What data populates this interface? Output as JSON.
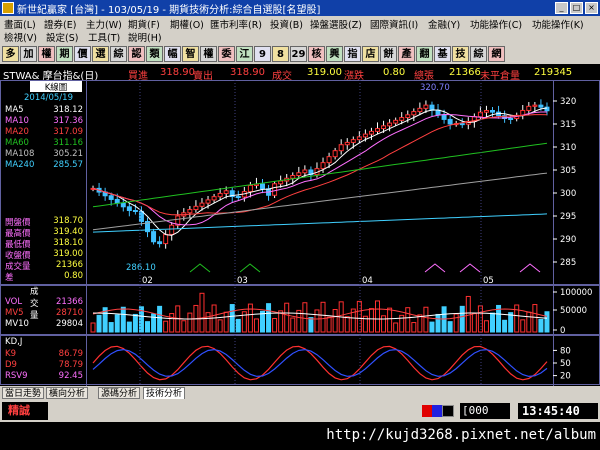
{
  "window": {
    "title": "新世紀贏家 [台灣] - 103/05/19 - 期貨技術分析:綜合自選股[名望股]"
  },
  "menus": {
    "row1": [
      "畫面(L)",
      "證券(E)",
      "主力(W)",
      "期貨(F)",
      "期權(O)",
      "匯市利率(R)",
      "投資(B)",
      "操盤選股(Z)",
      "國際資訊(I)",
      "金融(Y)",
      "功能操作(C)",
      "功能操作(K)"
    ],
    "row2": [
      "檢視(V)",
      "設定(S)",
      "工具(T)",
      "說明(H)"
    ]
  },
  "toolbar": [
    "多",
    "加",
    "權",
    "期",
    "價",
    "選",
    "綜",
    "認",
    "類",
    "幅",
    "智",
    "權",
    "委",
    "江",
    "9",
    "8",
    "29",
    "核",
    "興",
    "指",
    "店",
    "餅",
    "產",
    "翻",
    "基",
    "技",
    "綜",
    "網"
  ],
  "info": {
    "symbol": "STWA& 摩台指&(日)",
    "buy_label": "買進",
    "buy": "318.90",
    "sell_label": "賣出",
    "sell": "318.90",
    "deal_label": "成交",
    "deal": "319.00",
    "change_label": "漲跌",
    "change": "0.80",
    "vol_label": "總張",
    "vol": "21366",
    "oi_label": "未平倉量",
    "oi": "219345"
  },
  "kpanel": {
    "title": "K線圖",
    "date": "2014/05/19",
    "ma": [
      {
        "label": "MA5",
        "value": "318.12",
        "color": "#ffffff"
      },
      {
        "label": "MA10",
        "value": "317.36",
        "color": "#ff70ff"
      },
      {
        "label": "MA20",
        "value": "317.09",
        "color": "#ff4040"
      },
      {
        "label": "MA60",
        "value": "311.16",
        "color": "#20c020"
      },
      {
        "label": "MA108",
        "value": "305.21",
        "color": "#c0c0c0"
      },
      {
        "label": "MA240",
        "value": "285.57",
        "color": "#40d0ff"
      }
    ],
    "prices": [
      {
        "label": "開盤價",
        "value": "318.70"
      },
      {
        "label": "最高價",
        "value": "319.40"
      },
      {
        "label": "最低價",
        "value": "318.10"
      },
      {
        "label": "收盤價",
        "value": "319.00"
      },
      {
        "label": "成交量",
        "value": "21366"
      },
      {
        "label": "差",
        "value": "0.80"
      }
    ],
    "high_label": "320.70",
    "low_label": "286.10",
    "y_ticks": [
      "320",
      "315",
      "310",
      "305",
      "300",
      "295",
      "290",
      "285"
    ],
    "x_ticks": [
      "02",
      "03",
      "04",
      "05"
    ]
  },
  "volpanel": {
    "title": "成交量",
    "rows": [
      {
        "label": "VOL",
        "value": "21366",
        "color": "#ff70ff"
      },
      {
        "label": "MV5",
        "value": "28710",
        "color": "#ff4040"
      },
      {
        "label": "MV10",
        "value": "29804",
        "color": "#ffffff"
      }
    ],
    "y_ticks": [
      "100000",
      "50000",
      "0"
    ]
  },
  "kdpanel": {
    "title": "KD,J",
    "rows": [
      {
        "label": "K9",
        "value": "86.79",
        "color": "#ff4040"
      },
      {
        "label": "D9",
        "value": "78.79",
        "color": "#ff4040"
      },
      {
        "label": "RSV9",
        "value": "92.45",
        "color": "#ff70ff"
      }
    ],
    "y_ticks": [
      "80",
      "50",
      "20"
    ]
  },
  "tabs": [
    "當日走勢",
    "橫向分析",
    "源碼分析",
    "技術分析"
  ],
  "status": {
    "name": "精誠",
    "counter": "000",
    "time": "13:45:40"
  },
  "footer_url": "http://kujd3268.pixnet.net/album"
}
